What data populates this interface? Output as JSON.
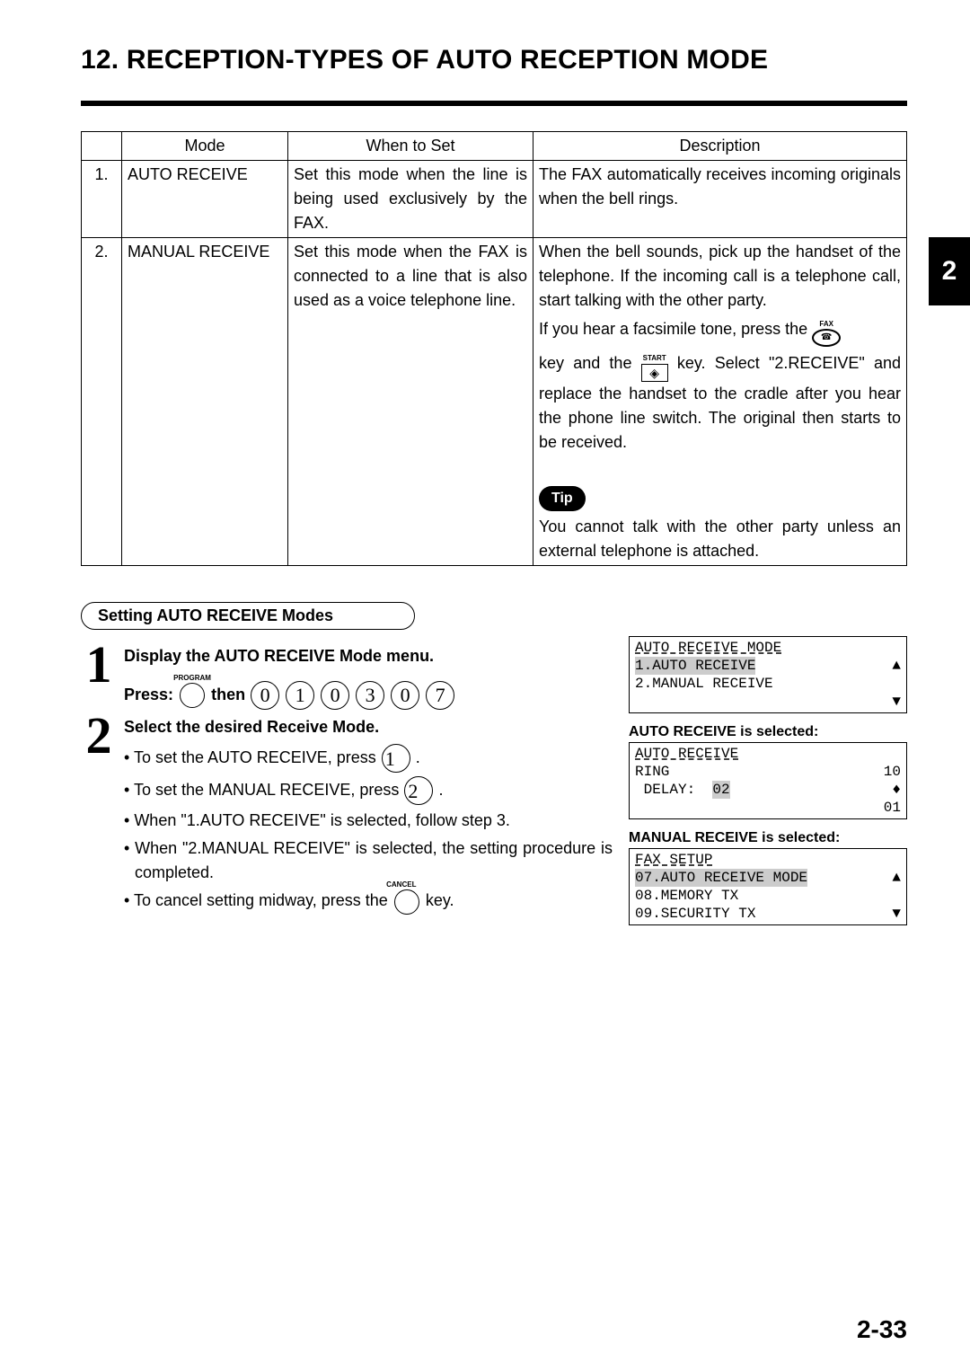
{
  "title": "12. RECEPTION-TYPES OF AUTO RECEPTION MODE",
  "chapter_tab": "2",
  "page_number": "2-33",
  "table": {
    "headers": {
      "num": "",
      "mode": "Mode",
      "when": "When to Set",
      "desc": "Description"
    },
    "rows": [
      {
        "num": "1.",
        "mode": "AUTO RECEIVE",
        "when": "Set this mode when the line is being used exclusively by the FAX.",
        "desc_plain": "The FAX automatically receives incoming originals when the bell rings."
      },
      {
        "num": "2.",
        "mode": "MANUAL RECEIVE",
        "when": "Set this mode when the FAX is connected to a line that is also used as a voice telephone line.",
        "desc_line1": "When the bell sounds, pick up the handset of the telephone. If the incoming call is a telephone call, start talking with the other party.",
        "desc_line2a": "If you hear a facsimile tone, press the ",
        "desc_line2b": " key and the ",
        "desc_line2c": " key. Select \"2.RECEIVE\" and replace the handset to the cradle after you hear the phone line switch. The original then starts to be received.",
        "tip_label": "Tip",
        "tip_text": "You cannot talk with the other party unless an external telephone is attached.",
        "fax_label": "FAX",
        "start_label": "START",
        "diamond_symbol": "◈"
      }
    ]
  },
  "setting": {
    "pill": "Setting AUTO RECEIVE Modes",
    "step1": {
      "num": "1",
      "head": "Display the AUTO RECEIVE Mode menu.",
      "press": "Press:",
      "program_label": "PROGRAM",
      "then": "then",
      "digits": [
        "0",
        "1",
        "0",
        "3",
        "0",
        "7"
      ]
    },
    "step2": {
      "num": "2",
      "head": "Select the desired Receive Mode.",
      "b1a": "To set the AUTO RECEIVE, press ",
      "b1_key": "1",
      "b1c": ".",
      "b2a": "To set the MANUAL RECEIVE, press ",
      "b2_key": "2",
      "b2c": ".",
      "b3": "When \"1.AUTO RECEIVE\" is selected, follow step 3.",
      "b4": "When \"2.MANUAL RECEIVE\" is selected, the setting procedure is completed.",
      "b5a": "To cancel setting midway, press the ",
      "cancel_label": "CANCEL",
      "b5c": " key."
    },
    "lcd1": {
      "l1": "AUTO RECEIVE MODE",
      "l2": "1.AUTO RECEIVE",
      "l3": "2.MANUAL RECEIVE",
      "up": "▲",
      "down": "▼"
    },
    "right_head1": "AUTO RECEIVE is selected:",
    "lcd2": {
      "l1": "AUTO RECEIVE",
      "l2a": "RING",
      "l2b": "10",
      "l3a": " DELAY:",
      "l3b": "02",
      "updown": "♦",
      "l4": "01"
    },
    "right_head2": "MANUAL RECEIVE is selected:",
    "lcd3": {
      "l1": "FAX SETUP",
      "l2": "07.AUTO RECEIVE MODE",
      "l3": "08.MEMORY TX",
      "l4": "09.SECURITY TX",
      "up": "▲",
      "down": "▼"
    }
  },
  "chart_data": {
    "type": "table",
    "title": "Reception mode descriptions",
    "columns": [
      "#",
      "Mode",
      "When to Set",
      "Description"
    ],
    "rows": [
      [
        "1.",
        "AUTO RECEIVE",
        "Set this mode when the line is being used exclusively by the FAX.",
        "The FAX automatically receives incoming originals when the bell rings."
      ],
      [
        "2.",
        "MANUAL RECEIVE",
        "Set this mode when the FAX is connected to a line that is also used as a voice telephone line.",
        "When the bell sounds, pick up the handset of the telephone. If the incoming call is a telephone call, start talking with the other party. If you hear a facsimile tone, press the FAX key and the START key. Select \"2.RECEIVE\" and replace the handset to the cradle after you hear the phone line switch. The original then starts to be received. Tip: You cannot talk with the other party unless an external telephone is attached."
      ]
    ]
  }
}
